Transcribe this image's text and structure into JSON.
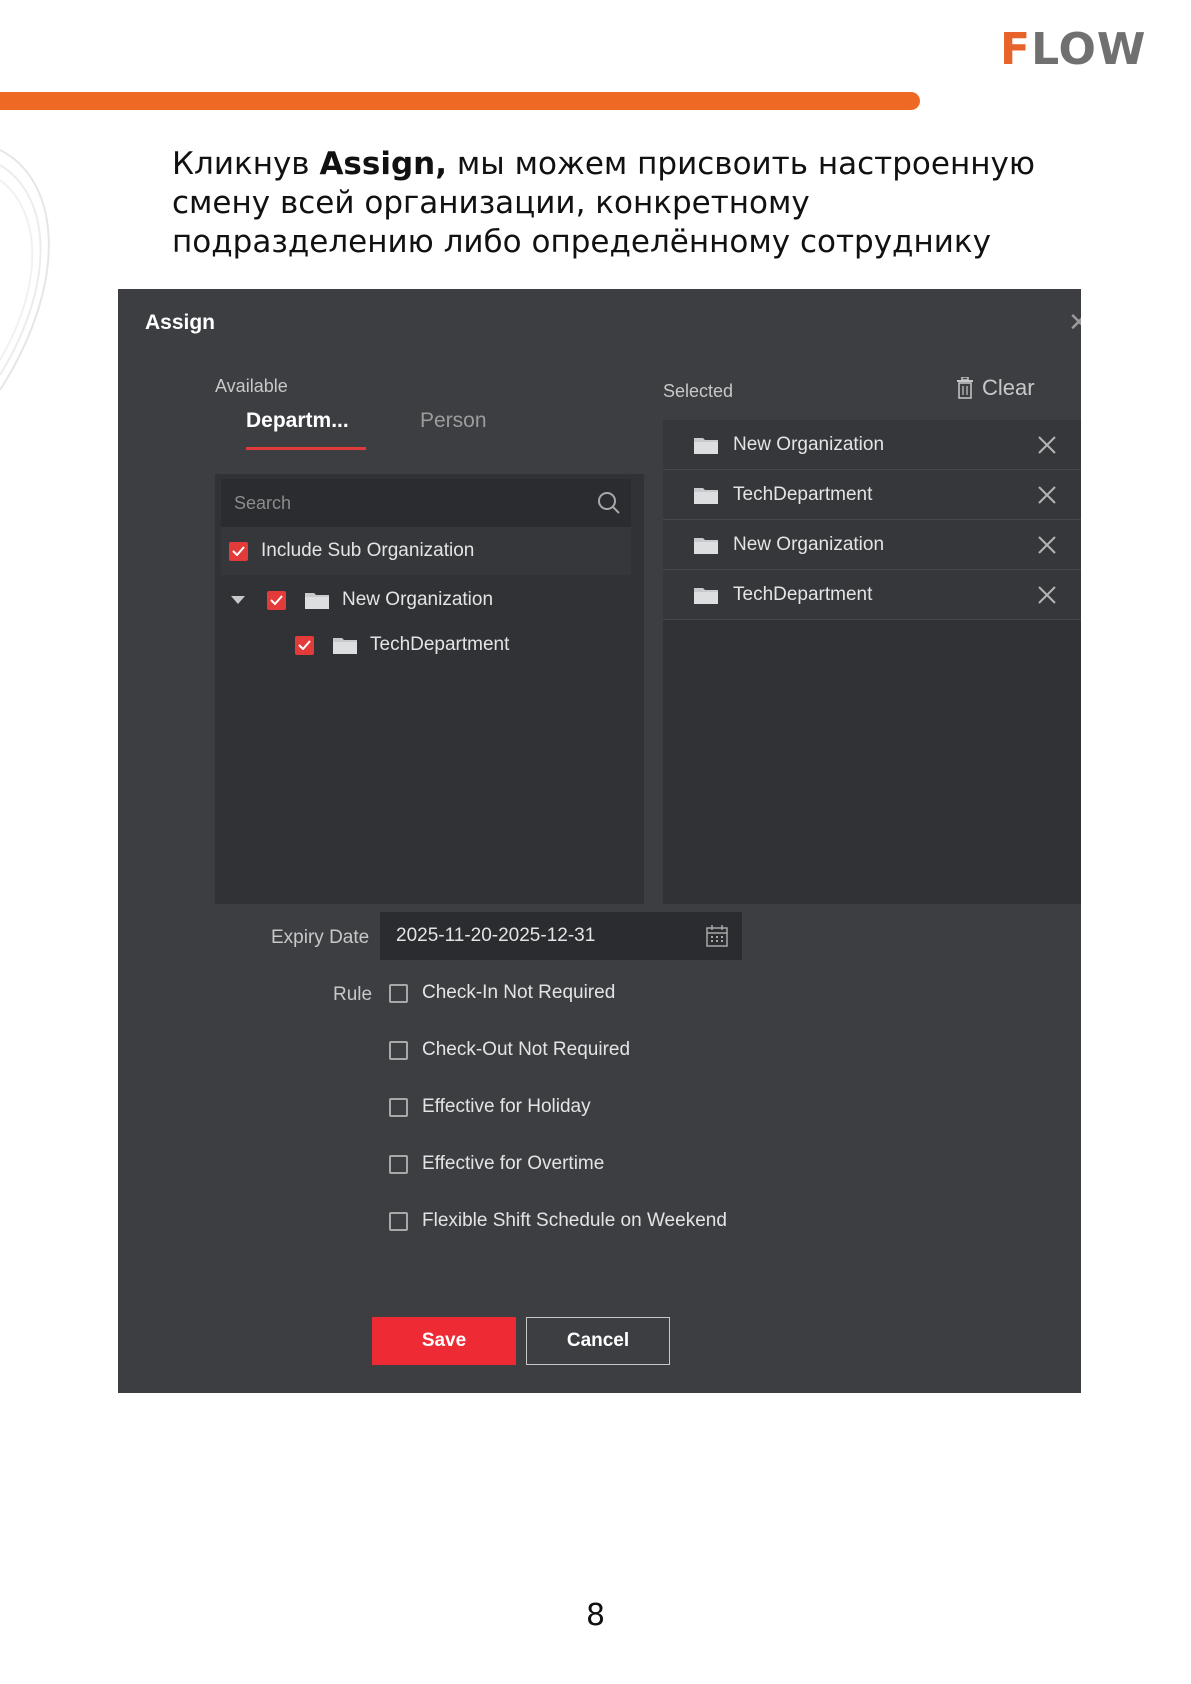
{
  "header": {
    "logo_mark": "F",
    "logo_rest": "LOW",
    "brand_color": "#ee6a24"
  },
  "intro": {
    "lead": "Кликнув ",
    "bold": "Assign,",
    "rest": " мы можем присвоить настроенную смену всей организации, конкретному подразделению либо определённому сотруднику"
  },
  "dialog": {
    "title": "Assign",
    "close_icon": "close-icon",
    "available_label": "Available",
    "selected_label": "Selected",
    "clear_label": "Clear",
    "tabs": [
      {
        "label": "Departm...",
        "active": true
      },
      {
        "label": "Person",
        "active": false
      }
    ],
    "search_placeholder": "Search",
    "include_sub": {
      "label": "Include Sub Organization",
      "checked": true
    },
    "tree": [
      {
        "label": "New Organization",
        "checked": true,
        "expanded": true
      },
      {
        "label": "TechDepartment",
        "checked": true
      }
    ],
    "selected_items": [
      "New Organization",
      "TechDepartment",
      "New Organization",
      "TechDepartment"
    ],
    "expiry_label": "Expiry Date",
    "expiry_value": "2025-11-20-2025-12-31",
    "rule_label": "Rule",
    "rules": [
      {
        "label": "Check-In Not Required",
        "checked": false
      },
      {
        "label": "Check-Out Not Required",
        "checked": false
      },
      {
        "label": "Effective for Holiday",
        "checked": false
      },
      {
        "label": "Effective for Overtime",
        "checked": false
      },
      {
        "label": "Flexible Shift Schedule on Weekend",
        "checked": false
      }
    ],
    "save_label": "Save",
    "cancel_label": "Cancel",
    "accent_color": "#ee2b34"
  },
  "page_number": "8"
}
